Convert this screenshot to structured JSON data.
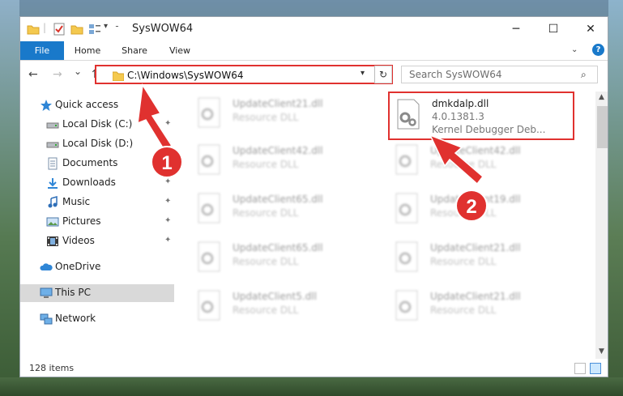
{
  "window": {
    "title": "SysWOW64",
    "controls": {
      "minimize": "─",
      "maximize": "☐",
      "close": "✕"
    }
  },
  "ribbon": {
    "tabs": [
      "File",
      "Home",
      "Share",
      "View"
    ],
    "help": "?"
  },
  "nav": {
    "back": "←",
    "forward": "→",
    "recent": "⌄",
    "up": "↑",
    "address": "C:\\Windows\\SysWOW64",
    "refresh": "↻",
    "search_placeholder": "Search SysWOW64"
  },
  "sidebar": {
    "items": [
      {
        "label": "Quick access",
        "icon": "star-icon"
      },
      {
        "label": "Local Disk (C:)",
        "icon": "drive-icon",
        "pinned": true
      },
      {
        "label": "Local Disk (D:)",
        "icon": "drive-icon",
        "pinned": true
      },
      {
        "label": "Documents",
        "icon": "documents-icon",
        "pinned": true
      },
      {
        "label": "Downloads",
        "icon": "downloads-icon",
        "pinned": true
      },
      {
        "label": "Music",
        "icon": "music-icon",
        "pinned": true
      },
      {
        "label": "Pictures",
        "icon": "pictures-icon",
        "pinned": true
      },
      {
        "label": "Videos",
        "icon": "videos-icon",
        "pinned": true
      },
      {
        "label": "OneDrive",
        "icon": "cloud-icon"
      },
      {
        "label": "This PC",
        "icon": "computer-icon"
      },
      {
        "label": "Network",
        "icon": "network-icon"
      }
    ],
    "pin": "📌"
  },
  "files": {
    "left": [
      {
        "name": "UpdateClient21.dll",
        "type": "Resource DLL"
      },
      {
        "name": "UpdateClient42.dll",
        "type": "Resource DLL"
      },
      {
        "name": "UpdateClient65.dll",
        "type": "Resource DLL"
      },
      {
        "name": "UpdateClient65.dll",
        "type": "Resource DLL"
      },
      {
        "name": "UpdateClient5.dll",
        "type": "Resource DLL"
      }
    ],
    "right": [
      {
        "name": "dmkdalp.dll",
        "version": "4.0.1381.3",
        "description": "Kernel Debugger Deb..."
      },
      {
        "name": "UpdateClient42.dll",
        "type": "Resource DLL"
      },
      {
        "name": "UpdateClient19.dll",
        "type": "Resource DLL"
      },
      {
        "name": "UpdateClient21.dll",
        "type": "Resource DLL"
      },
      {
        "name": "UpdateClient21.dll",
        "type": "Resource DLL"
      }
    ]
  },
  "status": {
    "item_count": "128 items"
  },
  "annotations": {
    "step1": "1",
    "step2": "2"
  },
  "colors": {
    "accent": "#1979ca",
    "highlight": "#e0312f",
    "selection": "#cce8ff"
  }
}
